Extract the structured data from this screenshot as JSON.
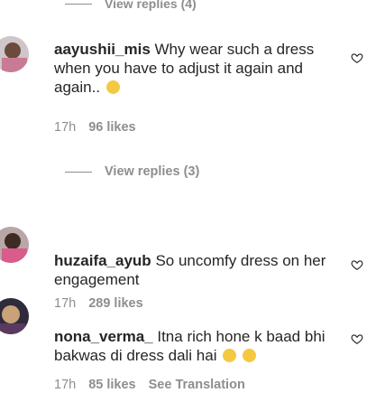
{
  "top_replies": {
    "label": "View replies (4)"
  },
  "comments": [
    {
      "username": "aayushii_mis",
      "text": "Why wear such a dress when you have to adjust it again and again..",
      "emoji": "😟",
      "time": "17h",
      "likes": "96 likes",
      "avatar": "avatar-image"
    },
    {
      "username": "huzaifa_ayub",
      "text": "So uncomfy dress on her engagement",
      "time": "17h",
      "likes": "289 likes",
      "avatar": "avatar-image"
    },
    {
      "username": "nona_verma_",
      "text": "Itna rich hone k baad bhi bakwas di dress dali hai",
      "emoji": "😒 😒",
      "time": "17h",
      "likes": "85 likes",
      "translation": "See Translation",
      "avatar": "avatar-image"
    }
  ],
  "view_replies": {
    "label": "View replies (3)"
  },
  "icons": {
    "like": "heart-outline-icon"
  },
  "colors": {
    "text": "#262626",
    "muted": "#8e8e8e",
    "background": "#ffffff"
  }
}
